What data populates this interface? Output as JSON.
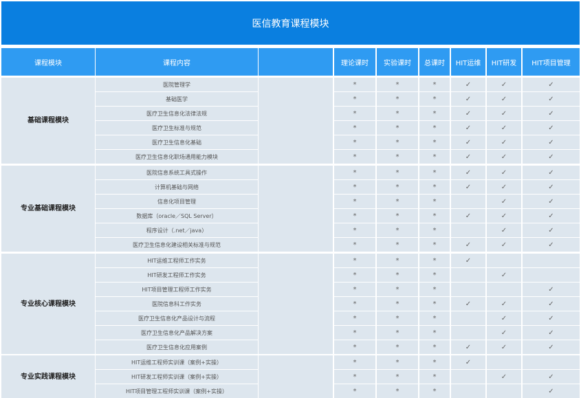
{
  "title": "医信教育课程模块",
  "headers": [
    "课程模块",
    "课程内容",
    "",
    "理论课时",
    "实验课时",
    "总课时",
    "HIT运维",
    "HIT研发",
    "HIT项目管理"
  ],
  "symbols": {
    "mark": "*",
    "check": "✓"
  },
  "modules": [
    {
      "lines": [
        "基础课程模块"
      ],
      "rows": [
        {
          "name": "医院管理学",
          "hit": [
            1,
            1,
            1
          ]
        },
        {
          "name": "基础医学",
          "hit": [
            1,
            1,
            1
          ]
        },
        {
          "name": "医疗卫生信息化法律法规",
          "hit": [
            1,
            1,
            1
          ]
        },
        {
          "name": "医疗卫生标准与规范",
          "hit": [
            1,
            1,
            1
          ]
        },
        {
          "name": "医疗卫生信息化基础",
          "hit": [
            1,
            1,
            1
          ]
        },
        {
          "name": "医疗卫生信息化职场通用能力模块",
          "hit": [
            1,
            1,
            1
          ]
        }
      ]
    },
    {
      "lines": [
        "专业基础",
        "课程模块"
      ],
      "rows": [
        {
          "name": "医院信息系统工具式操作",
          "hit": [
            1,
            1,
            1
          ]
        },
        {
          "name": "计算机基础与网络",
          "hit": [
            1,
            1,
            1
          ]
        },
        {
          "name": "信息化项目管理",
          "hit": [
            0,
            1,
            1
          ]
        },
        {
          "name": "数据库（oracle／SQL Server）",
          "hit": [
            1,
            1,
            1
          ]
        },
        {
          "name": "程序设计（.net／java）",
          "hit": [
            0,
            1,
            1
          ]
        },
        {
          "name": "医疗卫生信息化建设相关标准与规范",
          "hit": [
            1,
            1,
            1
          ]
        }
      ]
    },
    {
      "lines": [
        "专业核心",
        "课程模块"
      ],
      "rows": [
        {
          "name": "HIT运维工程师工作实务",
          "hit": [
            1,
            0,
            0
          ]
        },
        {
          "name": "HIT研发工程师工作实务",
          "hit": [
            0,
            1,
            0
          ]
        },
        {
          "name": "HIT项目管理工程师工作实务",
          "hit": [
            0,
            0,
            1
          ]
        },
        {
          "name": "医院信息科工作实务",
          "hit": [
            1,
            1,
            1
          ]
        },
        {
          "name": "医疗卫生信息化产品设计与流程",
          "hit": [
            0,
            1,
            1
          ]
        },
        {
          "name": "医疗卫生信息化产品解决方案",
          "hit": [
            0,
            1,
            1
          ]
        },
        {
          "name": "医疗卫生信息化应用案例",
          "hit": [
            1,
            1,
            1
          ]
        }
      ]
    },
    {
      "lines": [
        "专业实践",
        "课程模块"
      ],
      "rows": [
        {
          "name": "HIT运维工程师实训课（案例+实操）",
          "hit": [
            1,
            0,
            0
          ]
        },
        {
          "name": "HIT研发工程师实训课（案例+实操）",
          "hit": [
            0,
            1,
            1
          ]
        },
        {
          "name": "HIT项目管理工程师实训课（案例+实操）",
          "hit": [
            0,
            0,
            1
          ]
        }
      ]
    }
  ]
}
